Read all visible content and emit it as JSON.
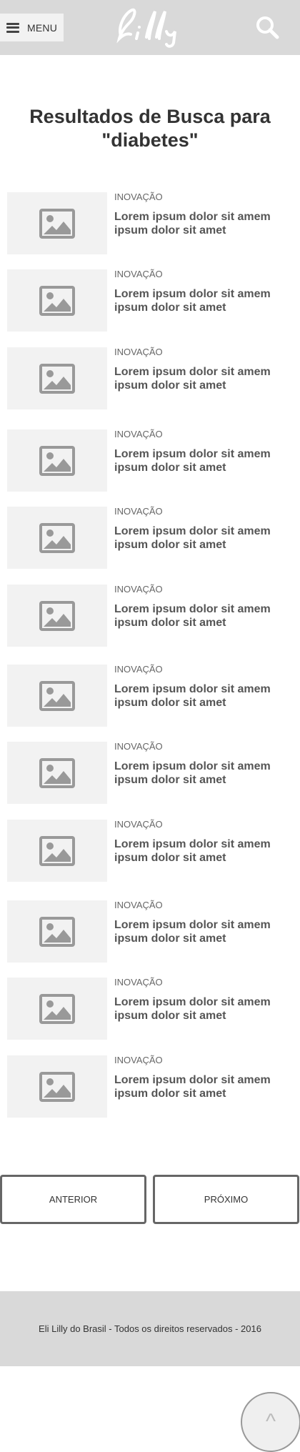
{
  "header": {
    "menu_label": "MENU",
    "logo_text": "Lilly"
  },
  "page_title": "Resultados de Busca para \"diabetes\"",
  "results": [
    {
      "category": "INOVAÇÃO",
      "title": "Lorem ipsum dolor sit amem ipsum dolor sit amet"
    },
    {
      "category": "INOVAÇÃO",
      "title": "Lorem ipsum dolor sit amem ipsum dolor sit amet"
    },
    {
      "category": "INOVAÇÃO",
      "title": "Lorem ipsum dolor sit amem ipsum dolor sit amet"
    },
    {
      "category": "INOVAÇÃO",
      "title": "Lorem ipsum dolor sit amem ipsum dolor sit amet"
    },
    {
      "category": "INOVAÇÃO",
      "title": "Lorem ipsum dolor sit amem ipsum dolor sit amet"
    },
    {
      "category": "INOVAÇÃO",
      "title": "Lorem ipsum dolor sit amem ipsum dolor sit amet"
    },
    {
      "category": "INOVAÇÃO",
      "title": "Lorem ipsum dolor sit amem ipsum dolor sit amet"
    },
    {
      "category": "INOVAÇÃO",
      "title": "Lorem ipsum dolor sit amem ipsum dolor sit amet"
    },
    {
      "category": "INOVAÇÃO",
      "title": "Lorem ipsum dolor sit amem ipsum dolor sit amet"
    },
    {
      "category": "INOVAÇÃO",
      "title": "Lorem ipsum dolor sit amem ipsum dolor sit amet"
    },
    {
      "category": "INOVAÇÃO",
      "title": "Lorem ipsum dolor sit amem ipsum dolor sit amet"
    },
    {
      "category": "INOVAÇÃO",
      "title": "Lorem ipsum dolor sit amem ipsum dolor sit amet"
    }
  ],
  "pagination": {
    "prev_label": "ANTERIOR",
    "next_label": "PRÓXIMO"
  },
  "footer": {
    "text": "Eli Lilly do Brasil - Todos os direitos reservados - 2016"
  },
  "back_to_top": {
    "label": "^"
  },
  "colors": {
    "header_bg": "#d9d9d9",
    "placeholder_bg": "#f2f2f2",
    "icon_gray": "#999999"
  },
  "icons": {
    "menu": "hamburger-icon",
    "search": "search-icon",
    "thumbnail": "image-placeholder-icon"
  }
}
